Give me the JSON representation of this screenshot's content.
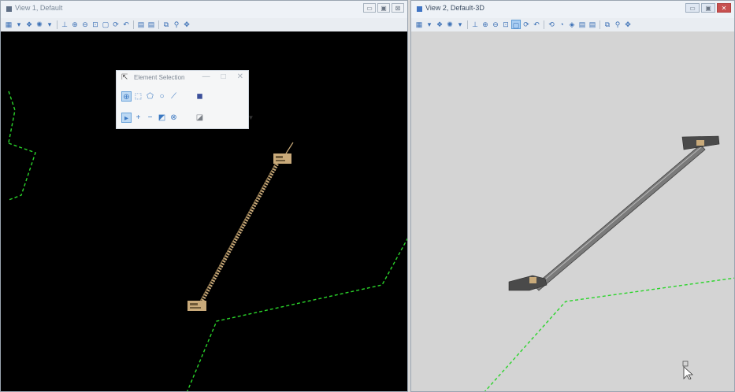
{
  "view1": {
    "title": "View 1, Default",
    "window_buttons": [
      "▭",
      "▣",
      "⊠"
    ],
    "toolbar_icons": [
      "view-attributes",
      "dropdown",
      "display-style",
      "lights",
      "dropdown",
      "update",
      "zoom-in",
      "zoom-out",
      "window-area",
      "fit-view",
      "rotate",
      "undo",
      "copy",
      "copy",
      "view-previous",
      "zoom-search",
      "pan"
    ]
  },
  "view2": {
    "title": "View 2, Default-3D",
    "window_buttons": [
      "▭",
      "▣",
      "✕"
    ],
    "toolbar_icons": [
      "view-attributes",
      "dropdown",
      "display-style",
      "lights",
      "dropdown",
      "update",
      "zoom-in",
      "zoom-out",
      "window-area",
      "fit-view",
      "rotate",
      "undo",
      "walk",
      "camera",
      "clip",
      "copy",
      "copy",
      "view-previous",
      "zoom-search",
      "pan"
    ]
  },
  "element_selection": {
    "title": "Element Selection",
    "minimize": "—",
    "maximize": "□",
    "close": "✕",
    "method_tools": [
      "individual",
      "block",
      "shape",
      "line",
      "circle"
    ],
    "mode_tools": [
      "new",
      "add",
      "subtract",
      "invert",
      "clear"
    ],
    "more_arrow": "▼"
  },
  "colors": {
    "dashed_line": "#2ad42a",
    "element_tan": "#c9aa7a",
    "view1_bg": "#000000",
    "view2_bg": "#d4d4d4",
    "element_gray": "#6e6e6e"
  }
}
